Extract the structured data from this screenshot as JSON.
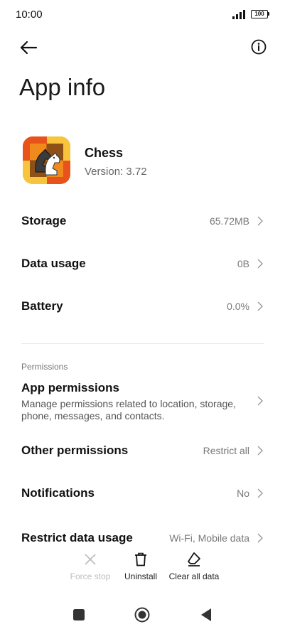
{
  "status_bar": {
    "time": "10:00",
    "battery_level": "100"
  },
  "header": {
    "title": "App info"
  },
  "app": {
    "name": "Chess",
    "version": "Version: 3.72"
  },
  "rows": {
    "storage": {
      "label": "Storage",
      "value": "65.72MB"
    },
    "data_usage": {
      "label": "Data usage",
      "value": "0B"
    },
    "battery": {
      "label": "Battery",
      "value": "0.0%"
    }
  },
  "permissions": {
    "section_label": "Permissions",
    "app_permissions": {
      "title": "App permissions",
      "description": "Manage permissions related to location, storage, phone, messages, and contacts."
    },
    "other_permissions": {
      "label": "Other permissions",
      "value": "Restrict all"
    },
    "notifications": {
      "label": "Notifications",
      "value": "No"
    },
    "restrict_data_usage": {
      "label": "Restrict data usage",
      "value": "Wi-Fi, Mobile data"
    }
  },
  "actions": {
    "force_stop": "Force stop",
    "uninstall": "Uninstall",
    "clear_all_data": "Clear all data"
  },
  "icons": {
    "back": "arrow-left-icon",
    "info": "info-circle-icon",
    "chevron": "chevron-right-icon",
    "force_stop": "close-x-icon",
    "uninstall": "trash-icon",
    "clear_data": "eraser-icon",
    "nav_recents": "square-icon",
    "nav_home": "circle-icon",
    "nav_back": "triangle-back-icon"
  },
  "colors": {
    "disabled_text": "#bdbdbd",
    "secondary_text": "#777777",
    "icon_orange": "#f08a1c",
    "icon_brown": "#7a3d12"
  }
}
